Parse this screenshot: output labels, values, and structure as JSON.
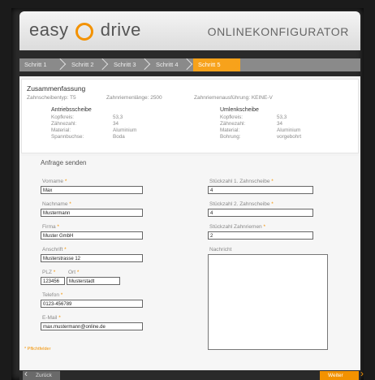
{
  "header": {
    "logo_left": "easy",
    "logo_right": "drive",
    "title": "ONLINEKONFIGURATOR"
  },
  "steps": [
    {
      "label": "Schritt 1"
    },
    {
      "label": "Schritt 2"
    },
    {
      "label": "Schritt 3"
    },
    {
      "label": "Schritt 4"
    },
    {
      "label": "Schritt 5"
    }
  ],
  "summary": {
    "title": "Zusammenfassung",
    "zahnscheibentyp": "Zahnscheibentyp: T5",
    "zahnriemenlaenge": "Zahnriemenlänge: 2500",
    "zahnriemenausfuehrung": "Zahnriemenausführung: KEINE-V",
    "antrieb": {
      "heading": "Antriebsscheibe",
      "rows": [
        {
          "key": "Kopfkreis:",
          "value": "53,3"
        },
        {
          "key": "Zähnezahl:",
          "value": "34"
        },
        {
          "key": "Material:",
          "value": "Aluminium"
        },
        {
          "key": "Spannbuchse:",
          "value": "Boda"
        }
      ]
    },
    "umlenk": {
      "heading": "Umlenkscheibe",
      "rows": [
        {
          "key": "Kopfkreis:",
          "value": "53,3"
        },
        {
          "key": "Zähnezahl:",
          "value": "34"
        },
        {
          "key": "Material:",
          "value": "Aluminium"
        },
        {
          "key": "Bohrung:",
          "value": "vorgebohrt"
        }
      ]
    }
  },
  "form": {
    "title": "Anfrage senden",
    "required_mark": "*",
    "vorname_label": "Vorname",
    "vorname_value": "Max",
    "nachname_label": "Nachname",
    "nachname_value": "Mustermann",
    "firma_label": "Firma",
    "firma_value": "Muster GmbH",
    "anschrift_label": "Anschrift",
    "anschrift_value": "Musterstrasse 12",
    "plz_label": "PLZ",
    "plz_value": "123456",
    "ort_label": "Ort",
    "ort_value": "Musterstadt",
    "telefon_label": "Telefon",
    "telefon_value": "0123-456789",
    "email_label": "E-Mail",
    "email_value": "max.mustermann@online.de",
    "stk1_label": "Stückzahl 1. Zahnscheibe",
    "stk1_value": "4",
    "stk2_label": "Stückzahl 2. Zahnscheibe",
    "stk2_value": "4",
    "stkr_label": "Stückzahl Zahnriemen",
    "stkr_value": "2",
    "nachricht_label": "Nachricht",
    "required_note": "* Pflichtfelder"
  },
  "nav": {
    "back_label": "Zurück",
    "next_label": "Weiter"
  },
  "colors": {
    "accent": "#f39200",
    "step_active": "#f7a21b"
  }
}
